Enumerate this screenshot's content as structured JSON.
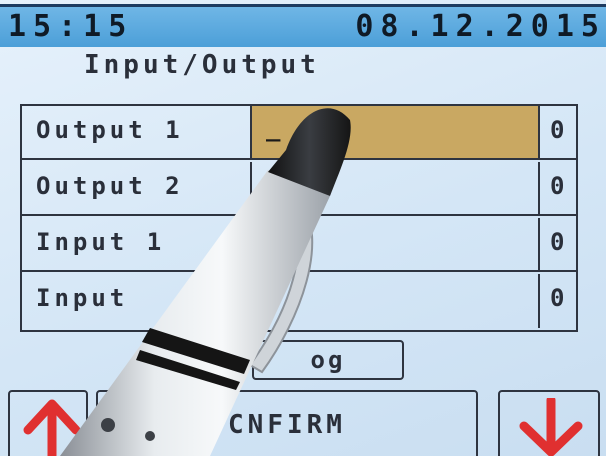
{
  "status_bar": {
    "time": "15:15",
    "date": "08.12.2015"
  },
  "page": {
    "title": "Input/Output"
  },
  "rows": [
    {
      "label": "Output 1",
      "value": "_",
      "state": "0",
      "active": true
    },
    {
      "label": "Output 2",
      "value": "",
      "state": "0",
      "active": false
    },
    {
      "label": "Input 1",
      "value": "",
      "state": "0",
      "active": false
    },
    {
      "label": "Input",
      "value": "",
      "state": "0",
      "active": false
    }
  ],
  "buttons": {
    "log_label": "og",
    "confirm_label": "CNFIRM"
  },
  "colors": {
    "status_bar": "#4c9fd8",
    "active_field": "#c9a862",
    "arrow": "#e03030",
    "screen_background": "#dcebf8"
  },
  "icons": {
    "up": "arrow-up-icon",
    "down": "arrow-down-icon"
  }
}
